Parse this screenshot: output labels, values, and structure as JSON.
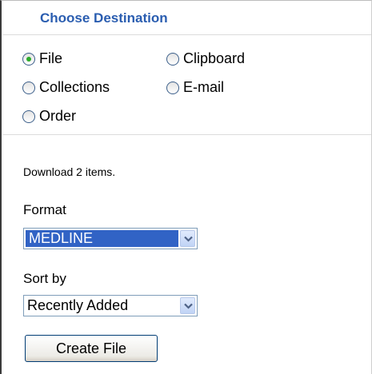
{
  "header": {
    "title": "Choose Destination"
  },
  "destinations": {
    "selected": "File",
    "file": "File",
    "clipboard": "Clipboard",
    "collections": "Collections",
    "email": "E-mail",
    "order": "Order"
  },
  "download": {
    "message": "Download 2 items.",
    "format_label": "Format",
    "format_value": "MEDLINE",
    "sort_label": "Sort by",
    "sort_value": "Recently Added",
    "button_label": "Create File"
  },
  "colors": {
    "title": "#2a5db0",
    "selection_highlight": "#3163c5",
    "radio_dot": "#2cab2c"
  },
  "icons": {
    "dropdown": "chevron-down-icon",
    "radio": "radio-button-icon"
  }
}
